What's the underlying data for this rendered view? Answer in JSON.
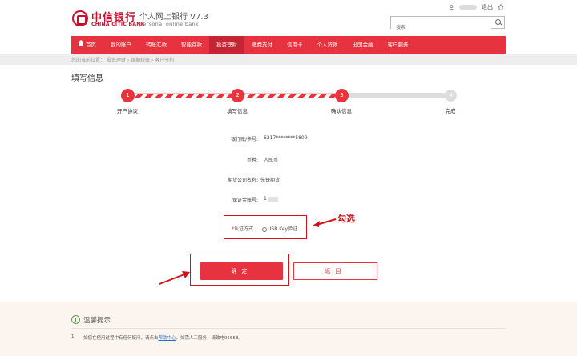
{
  "header": {
    "bank_name_cn": "中信银行",
    "bank_name_en": "CHINA CITIC BANK",
    "system_title": "个人网上银行 V7.3",
    "system_subtitle": "personal online bank",
    "logout_label": "退出",
    "search_placeholder": "搜索"
  },
  "nav": {
    "items": [
      {
        "label": "首页"
      },
      {
        "label": "我的账户"
      },
      {
        "label": "转账汇款"
      },
      {
        "label": "智能存款"
      },
      {
        "label": "投资理财"
      },
      {
        "label": "缴费支付"
      },
      {
        "label": "信用卡"
      },
      {
        "label": "个人贷款"
      },
      {
        "label": "出国金融"
      },
      {
        "label": "客户服务"
      }
    ],
    "active_index": 4
  },
  "breadcrumb": {
    "text": "您的当前位置： 投资理财 › 银期转账 › 客户签约"
  },
  "section_title": "填写信息",
  "steps": [
    {
      "num": "1",
      "label": "开户协议",
      "done": true
    },
    {
      "num": "2",
      "label": "填写信息",
      "done": true
    },
    {
      "num": "3",
      "label": "确认信息",
      "done": true
    },
    {
      "num": "4",
      "label": "完成",
      "done": false
    }
  ],
  "form": {
    "account_label": "银行账/卡号:",
    "account_value": "6217********5809",
    "currency_label": "币种:",
    "currency_value": "人民币",
    "company_label": "期货公司名称:",
    "company_value": "先锋期货",
    "margin_label": "保证金账号:",
    "margin_value": "1",
    "auth_label": "认证方式",
    "auth_required_mark": "*",
    "auth_option": "USB Key验证"
  },
  "annotation": {
    "text": "勾选"
  },
  "buttons": {
    "confirm_label": "确定",
    "back_label": "返回"
  },
  "tips": {
    "title": "温馨提示",
    "item_num": "1",
    "item_prefix": "如您在使用过程中有任何疑问，请点击",
    "item_link": "帮助中心",
    "item_suffix": "，如需人工服务，请致电95558。"
  },
  "colors": {
    "brand_red": "#e7333f",
    "annotation_red": "#d0121b"
  }
}
